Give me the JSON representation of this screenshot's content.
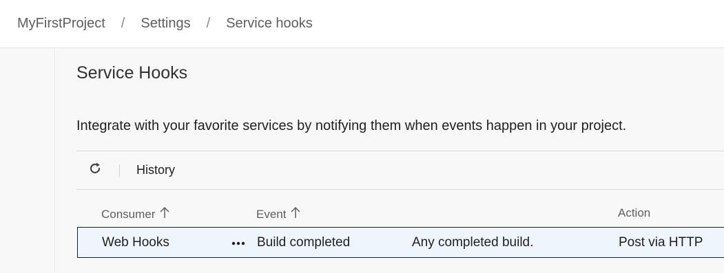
{
  "breadcrumb": {
    "project": "MyFirstProject",
    "separator": "/",
    "settings": "Settings",
    "current": "Service hooks"
  },
  "main": {
    "title": "Service Hooks",
    "description": "Integrate with your favorite services by notifying them when events happen in your project."
  },
  "toolbar": {
    "refresh_icon": "refresh-icon",
    "history_label": "History"
  },
  "grid": {
    "columns": [
      "Consumer",
      "Event",
      "Action"
    ],
    "rows": [
      {
        "consumer": "Web Hooks",
        "event": "Build completed",
        "event_detail": "Any completed build.",
        "action": "Post via HTTP"
      }
    ]
  },
  "colors": {
    "selected_row_bg": "#eef5fc",
    "page_bg": "#f8f8f8"
  }
}
